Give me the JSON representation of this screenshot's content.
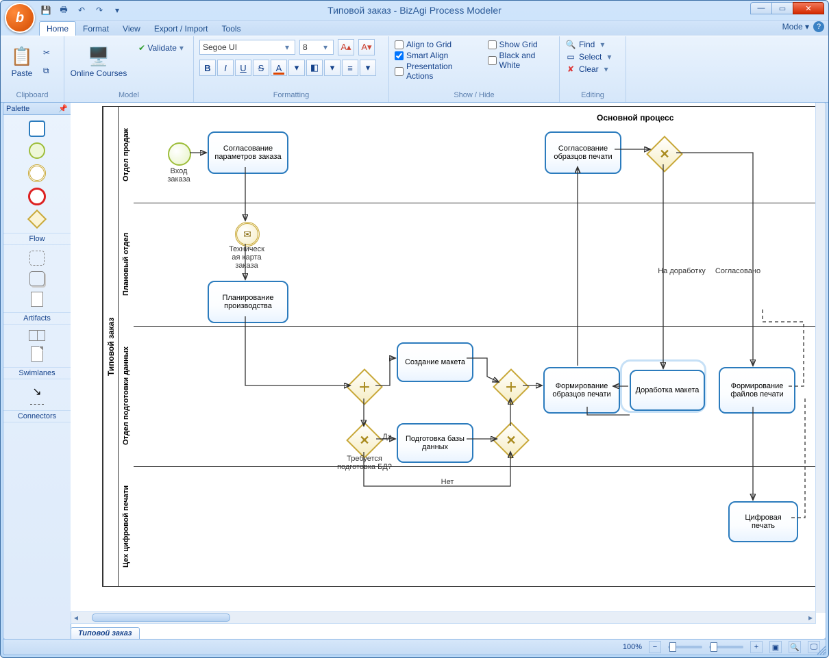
{
  "title": "Типовой заказ - BizAgi Process Modeler",
  "ribbon_tabs": [
    "Home",
    "Format",
    "View",
    "Export / Import",
    "Tools"
  ],
  "mode_label": "Mode",
  "groups": {
    "clipboard": "Clipboard",
    "model": "Model",
    "formatting": "Formatting",
    "showhide": "Show / Hide",
    "editing": "Editing"
  },
  "clipboard_paste": "Paste",
  "model_online": "Online Courses",
  "model_validate": "Validate",
  "font_name": "Segoe UI",
  "font_size": "8",
  "show": {
    "align_grid": "Align to Grid",
    "smart_align": "Smart Align",
    "pres_actions": "Presentation Actions",
    "show_grid": "Show Grid",
    "bw": "Black and White"
  },
  "edit": {
    "find": "Find",
    "select": "Select",
    "clear": "Clear"
  },
  "palette": {
    "title": "Palette",
    "cats": [
      "Flow",
      "Artifacts",
      "Swimlanes",
      "Connectors"
    ]
  },
  "doc_tab": "Типовой заказ",
  "zoom": "100%",
  "diagram": {
    "title": "Основной процесс",
    "pool": "Типовой заказ",
    "lanes": [
      "Отдел продаж",
      "Плановый отдел",
      "Отдел подготовки данных",
      "Цех цифровой печати"
    ],
    "start": "Вход заказа",
    "msg": "Техническ\nая карта\nзаказа",
    "tasks": {
      "t1": "Согласование параметров заказа",
      "t2": "Планирование производства",
      "t3": "Создание макета",
      "t4": "Подготовка базы данных",
      "t5": "Формирование образцов печати",
      "t6": "Согласование образцов печати",
      "t7": "Доработка макета",
      "t8": "Формирование файлов печати",
      "t9": "Цифровая печать"
    },
    "labels": {
      "q1": "Требуется подготовка БД?",
      "da": "Да",
      "net": "Нет",
      "rework": "На доработку",
      "agreed": "Согласовано"
    }
  }
}
